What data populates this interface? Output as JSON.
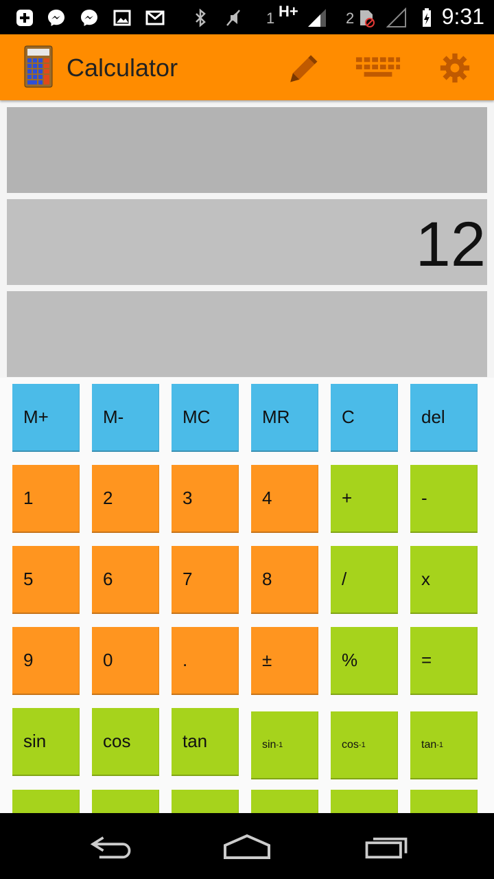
{
  "status_bar": {
    "time": "9:31",
    "sim1_label": "1",
    "network_type": "H+",
    "sim2_label": "2",
    "icons_left": [
      "add-icon",
      "messenger-icon",
      "messenger-icon",
      "image-icon",
      "gmail-icon"
    ],
    "icons_right": [
      "bluetooth-icon",
      "mute-icon",
      "signal-icon",
      "sim-card-icon",
      "signal-icon",
      "battery-charging-icon"
    ]
  },
  "action_bar": {
    "title": "Calculator",
    "accent_color": "#ff8c00",
    "actions": [
      "pencil-icon",
      "keyboard-icon",
      "settings-gear-icon"
    ]
  },
  "display": {
    "top_text": "",
    "current_value": "12",
    "bottom_text": ""
  },
  "keypad": {
    "row1": [
      "M+",
      "M-",
      "MC",
      "MR",
      "C",
      "del"
    ],
    "row2": [
      "1",
      "2",
      "3",
      "4",
      "+",
      "-"
    ],
    "row3": [
      "5",
      "6",
      "7",
      "8",
      "/",
      "x"
    ],
    "row4": [
      "9",
      "0",
      ".",
      "±",
      "%",
      "="
    ],
    "row5": [
      "sin",
      "cos",
      "tan"
    ],
    "inverse_base": [
      "sin",
      "cos",
      "tan"
    ],
    "inverse_sup": "-1",
    "colors": {
      "memory": "#4bbbe8",
      "digits": "#ff951f",
      "operators": "#a6d31c"
    }
  },
  "nav_bar": {
    "buttons": [
      "back-icon",
      "home-icon",
      "recent-apps-icon"
    ]
  }
}
